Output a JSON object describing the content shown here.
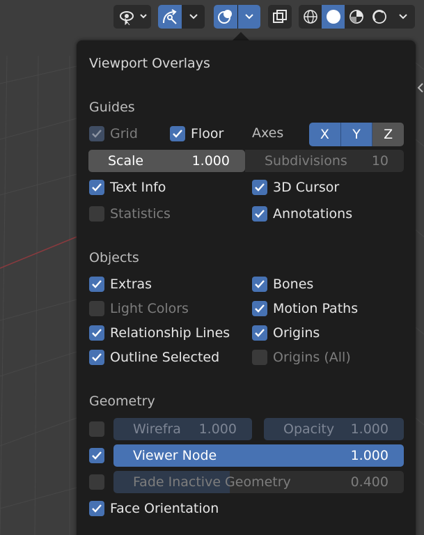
{
  "panel": {
    "title": "Viewport Overlays"
  },
  "guides": {
    "title": "Guides",
    "grid": {
      "label": "Grid",
      "checked": true,
      "enabled": false
    },
    "floor": {
      "label": "Floor",
      "checked": true
    },
    "axes": {
      "label": "Axes",
      "x": "X",
      "y": "Y",
      "z": "Z"
    },
    "scale": {
      "label": "Scale",
      "value": "1.000"
    },
    "subdivisions": {
      "label": "Subdivisions",
      "value": "10"
    },
    "text_info": {
      "label": "Text Info",
      "checked": true
    },
    "cursor_3d": {
      "label": "3D Cursor",
      "checked": true
    },
    "statistics": {
      "label": "Statistics",
      "checked": false
    },
    "annotations": {
      "label": "Annotations",
      "checked": true
    }
  },
  "objects": {
    "title": "Objects",
    "extras": {
      "label": "Extras",
      "checked": true
    },
    "bones": {
      "label": "Bones",
      "checked": true
    },
    "light_colors": {
      "label": "Light Colors",
      "checked": false
    },
    "motion_paths": {
      "label": "Motion Paths",
      "checked": true
    },
    "relationship_lines": {
      "label": "Relationship Lines",
      "checked": true
    },
    "origins": {
      "label": "Origins",
      "checked": true
    },
    "outline_selected": {
      "label": "Outline Selected",
      "checked": true
    },
    "origins_all": {
      "label": "Origins (All)",
      "checked": false
    }
  },
  "geometry": {
    "title": "Geometry",
    "wireframe": {
      "label": "Wirefra",
      "value": "1.000",
      "checked": false
    },
    "opacity": {
      "label": "Opacity",
      "value": "1.000"
    },
    "viewer_node": {
      "label": "Viewer Node",
      "value": "1.000",
      "checked": true
    },
    "fade_inactive": {
      "label": "Fade Inactive Geometry",
      "value": "0.400",
      "checked": false,
      "fraction": 0.4
    },
    "face_orientation": {
      "label": "Face Orientation",
      "checked": true
    }
  },
  "colors": {
    "accent": "#4772b3",
    "panel_bg": "#1d1d1d",
    "viewport_bg": "#3d3d3d"
  }
}
